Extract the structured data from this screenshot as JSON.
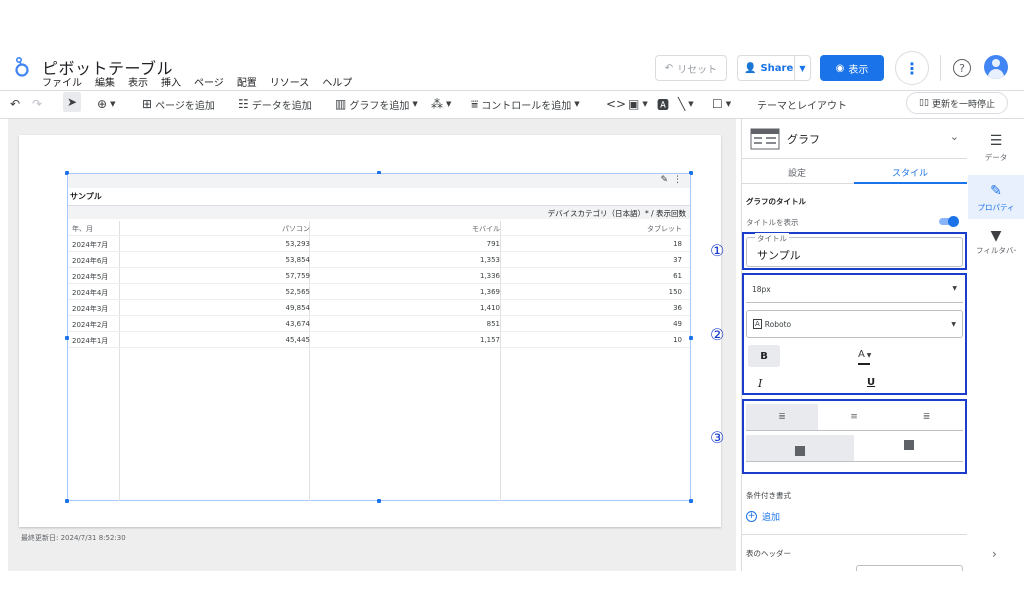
{
  "app": {
    "title": "ピボットテーブル"
  },
  "menu": [
    "ファイル",
    "編集",
    "表示",
    "挿入",
    "ページ",
    "配置",
    "リソース",
    "ヘルプ"
  ],
  "header": {
    "reset_label": "リセット",
    "share_label": "Share",
    "view_label": "表示"
  },
  "toolbar": {
    "add_page": "ページを追加",
    "add_data": "データを追加",
    "add_chart": "グラフを追加",
    "add_control": "コントロールを追加",
    "theme_layout": "テーマとレイアウト",
    "pause_updates": "更新を一時停止"
  },
  "report": {
    "last_updated": "最終更新日: 2024/7/31 8:52:30",
    "chart_title": "サンプル",
    "group_header": "デバイスカテゴリ（日本語）* / 表示回数",
    "columns": [
      "年、月",
      "パソコン",
      "モバイル",
      "タブレット"
    ],
    "rows": [
      [
        "2024年7月",
        "53,293",
        "791",
        "18"
      ],
      [
        "2024年6月",
        "53,854",
        "1,353",
        "37"
      ],
      [
        "2024年5月",
        "57,759",
        "1,336",
        "61"
      ],
      [
        "2024年4月",
        "52,565",
        "1,369",
        "150"
      ],
      [
        "2024年3月",
        "49,854",
        "1,410",
        "36"
      ],
      [
        "2024年2月",
        "43,674",
        "851",
        "49"
      ],
      [
        "2024年1月",
        "45,445",
        "1,157",
        "10"
      ]
    ]
  },
  "panel": {
    "chart_type": "グラフ",
    "tab_setup": "設定",
    "tab_style": "スタイル",
    "chart_title_section": "グラフのタイトル",
    "show_title": "タイトルを表示",
    "show_title_on": true,
    "title_field_label": "タイトル",
    "title_field_value": "サンプル",
    "font_size": "18px",
    "font_family": "Roboto",
    "bold": "B",
    "font_color": "A",
    "italic": "I",
    "underline": "U",
    "conditional_format": "条件付き書式",
    "add_label": "追加",
    "table_header": "表のヘッダー",
    "annotations": [
      "①",
      "②",
      "③"
    ]
  },
  "rail": [
    {
      "label": "データ",
      "icon": "table-icon"
    },
    {
      "label": "プロパティ",
      "icon": "pencil-icon"
    },
    {
      "label": "フィルタバー",
      "icon": "filter-icon"
    }
  ],
  "colors": {
    "accent": "#1a73e8",
    "annotation_box": "#1a3dcc"
  }
}
